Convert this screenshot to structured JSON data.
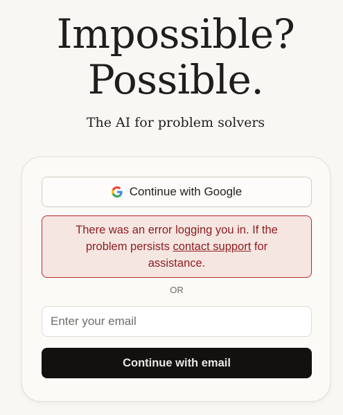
{
  "hero": {
    "line1": "Impossible?",
    "line2": "Possible.",
    "subtitle": "The AI for problem solvers"
  },
  "auth": {
    "google_button_label": "Continue with Google",
    "google_icon": "google-g-icon",
    "error": {
      "text_before": "There was an error logging you in. If the problem persists ",
      "link_text": "contact support",
      "text_after": " for assistance."
    },
    "divider": "OR",
    "email_placeholder": "Enter your email",
    "email_value": "",
    "email_button_label": "Continue with email"
  },
  "colors": {
    "background": "#f8f7f3",
    "error_text": "#8e1f20",
    "error_border": "#b22d2d",
    "error_background": "#f6e6e2",
    "primary_button": "#121110"
  }
}
